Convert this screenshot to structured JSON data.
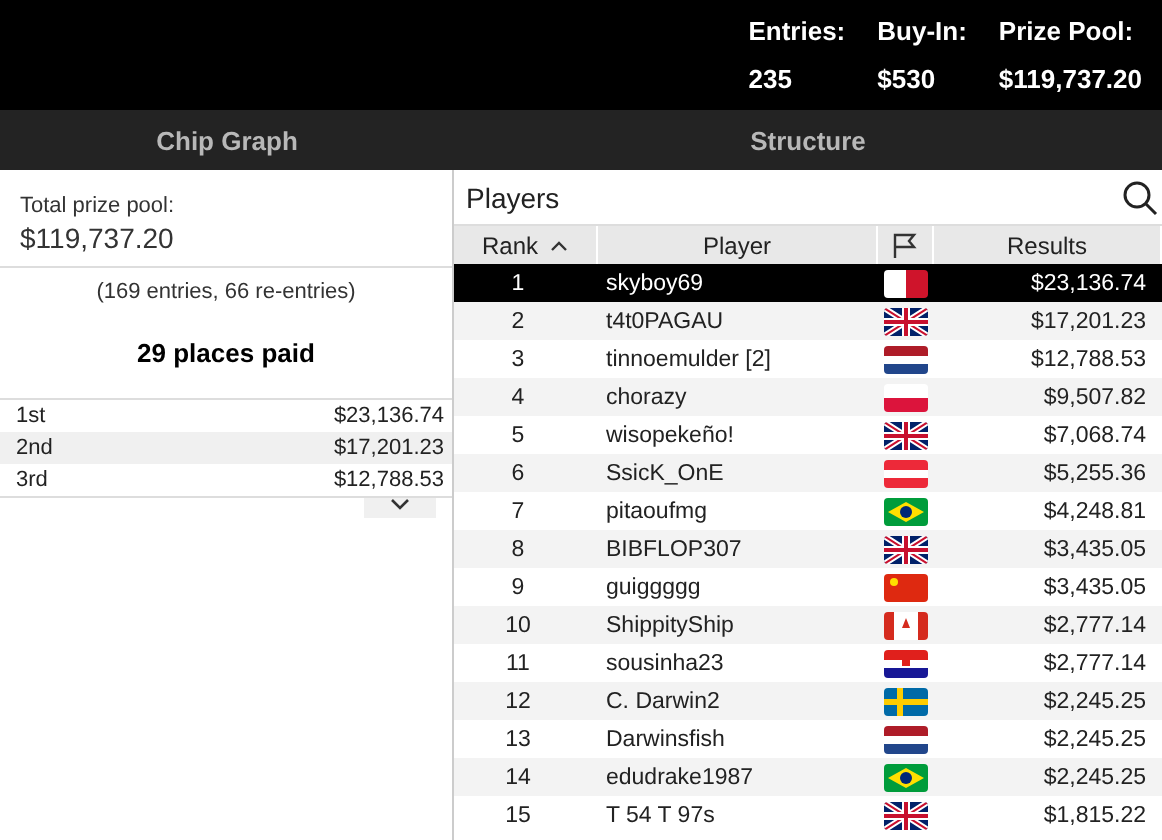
{
  "header": {
    "stats": [
      {
        "label": "Entries:",
        "value": "235"
      },
      {
        "label": "Buy-In:",
        "value": "$530"
      },
      {
        "label": "Prize Pool:",
        "value": "$119,737.20"
      }
    ]
  },
  "tabs": [
    {
      "label": "Chip Graph",
      "selected": false
    },
    {
      "label": "Structure",
      "selected": false
    }
  ],
  "prize_panel": {
    "label": "Total prize pool:",
    "amount": "$119,737.20",
    "entries_note": "(169 entries, 66 re-entries)",
    "places_paid": "29 places paid",
    "payouts": [
      {
        "place": "1st",
        "amount": "$23,136.74"
      },
      {
        "place": "2nd",
        "amount": "$17,201.23"
      },
      {
        "place": "3rd",
        "amount": "$12,788.53"
      }
    ]
  },
  "players": {
    "title": "Players",
    "columns": [
      "Rank",
      "Player",
      "Results"
    ],
    "rows": [
      {
        "rank": "1",
        "player": "skyboy69",
        "kind": "mt",
        "result": "$23,136.74",
        "selected": true
      },
      {
        "rank": "2",
        "player": "t4t0PAGAU",
        "kind": "gb",
        "result": "$17,201.23",
        "selected": false
      },
      {
        "rank": "3",
        "player": "tinnoemulder [2]",
        "kind": "nl",
        "result": "$12,788.53",
        "selected": false
      },
      {
        "rank": "4",
        "player": "chorazy",
        "kind": "pl",
        "result": "$9,507.82",
        "selected": false
      },
      {
        "rank": "5",
        "player": "wisopekeño!",
        "kind": "gb",
        "result": "$7,068.74",
        "selected": false
      },
      {
        "rank": "6",
        "player": "SsicK_OnE",
        "kind": "at",
        "result": "$5,255.36",
        "selected": false
      },
      {
        "rank": "7",
        "player": "pitaoufmg",
        "kind": "br",
        "result": "$4,248.81",
        "selected": false
      },
      {
        "rank": "8",
        "player": "BIBFLOP307",
        "kind": "gb",
        "result": "$3,435.05",
        "selected": false
      },
      {
        "rank": "9",
        "player": "guiggggg",
        "kind": "cn",
        "result": "$3,435.05",
        "selected": false
      },
      {
        "rank": "10",
        "player": "ShippityShip",
        "kind": "ca",
        "result": "$2,777.14",
        "selected": false
      },
      {
        "rank": "11",
        "player": "sousinha23",
        "kind": "hr",
        "result": "$2,777.14",
        "selected": false
      },
      {
        "rank": "12",
        "player": "C. Darwin2",
        "kind": "se",
        "result": "$2,245.25",
        "selected": false
      },
      {
        "rank": "13",
        "player": "Darwinsfish",
        "kind": "nl",
        "result": "$2,245.25",
        "selected": false
      },
      {
        "rank": "14",
        "player": "edudrake1987",
        "kind": "br",
        "result": "$2,245.25",
        "selected": false
      },
      {
        "rank": "15",
        "player": "T 54 T 97s",
        "kind": "gb",
        "result": "$1,815.22",
        "selected": false
      }
    ]
  }
}
